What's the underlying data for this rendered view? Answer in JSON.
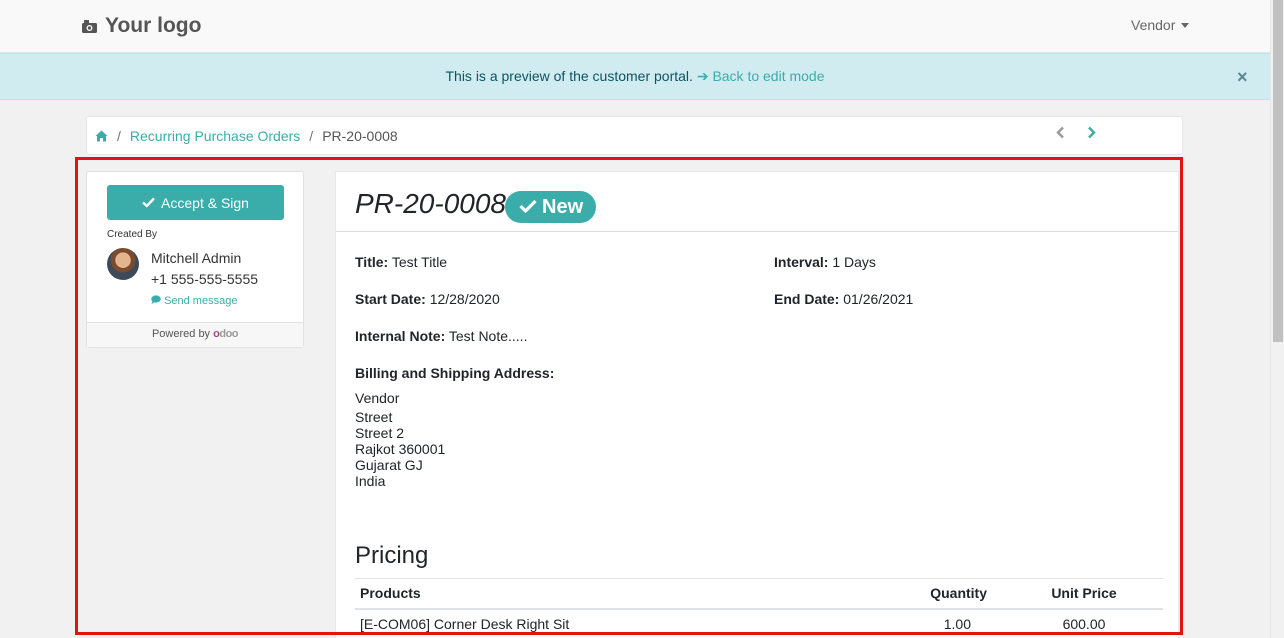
{
  "navbar": {
    "logo_text": "Your logo",
    "user_menu": "Vendor"
  },
  "banner": {
    "text": "This is a preview of the customer portal.",
    "link": "Back to edit mode",
    "close": "×"
  },
  "breadcrumb": {
    "items": [
      "Recurring Purchase Orders",
      "PR-20-0008"
    ]
  },
  "sidebar": {
    "accept_label": "Accept & Sign",
    "created_by_label": "Created By",
    "creator_name": "Mitchell Admin",
    "creator_phone": "+1 555-555-5555",
    "send_message": "Send message",
    "powered_by": "Powered by",
    "powered_brand": "odoo"
  },
  "order": {
    "number": "PR-20-0008",
    "status": "New",
    "title_label": "Title:",
    "title_value": "Test Title",
    "interval_label": "Interval:",
    "interval_value": "1 Days",
    "start_label": "Start Date:",
    "start_value": "12/28/2020",
    "end_label": "End Date:",
    "end_value": "01/26/2021",
    "note_label": "Internal Note:",
    "note_value": "Test Note.....",
    "address_label": "Billing and Shipping Address:",
    "address": [
      "Vendor",
      "Street",
      "Street 2",
      "Rajkot 360001",
      "Gujarat GJ",
      "India"
    ]
  },
  "pricing": {
    "title": "Pricing",
    "headers": [
      "Products",
      "Quantity",
      "Unit Price"
    ],
    "rows": [
      {
        "product": "[E-COM06] Corner Desk Right Sit",
        "quantity": "1.00",
        "unit_price": "600.00"
      }
    ]
  },
  "colors": {
    "accent": "#3aadaa",
    "banner_bg": "#d1ecf1",
    "highlight": "#e21313"
  }
}
